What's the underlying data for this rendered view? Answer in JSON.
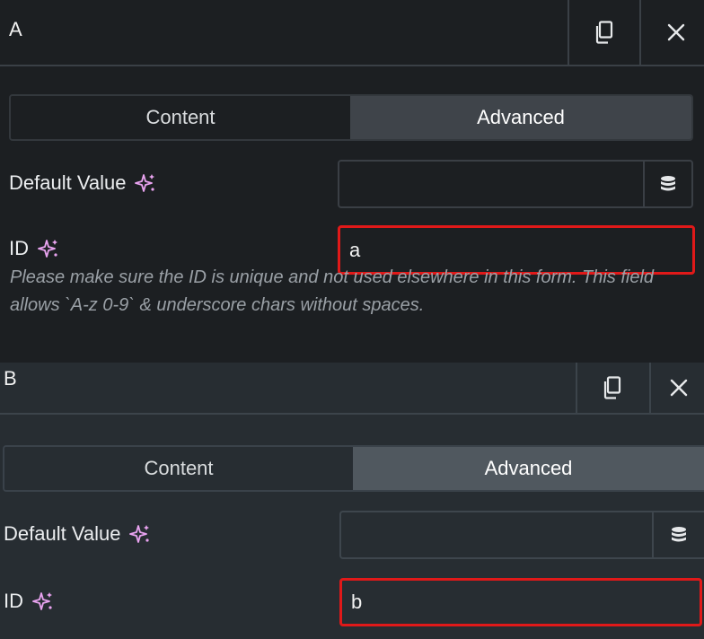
{
  "panels": [
    {
      "title": "A",
      "tabs": [
        {
          "label": "Content",
          "active": false
        },
        {
          "label": "Advanced",
          "active": true
        }
      ],
      "fields": {
        "default_value": {
          "label": "Default Value",
          "value": "",
          "icon": "database-icon"
        },
        "id": {
          "label": "ID",
          "value": "a"
        }
      },
      "help_text": "Please make sure the ID is unique and not used elsewhere in this form. This field allows `A-z 0-9` & underscore chars without spaces."
    },
    {
      "title": "B",
      "tabs": [
        {
          "label": "Content",
          "active": false
        },
        {
          "label": "Advanced",
          "active": true
        }
      ],
      "fields": {
        "default_value": {
          "label": "Default Value",
          "value": "",
          "icon": "database-icon"
        },
        "id": {
          "label": "ID",
          "value": "b"
        }
      }
    }
  ],
  "colors": {
    "panel_a_bg": "#1c1f22",
    "panel_b_bg": "#272d32",
    "highlight_border": "#e01919",
    "sparkle": "#e9a3f0"
  }
}
